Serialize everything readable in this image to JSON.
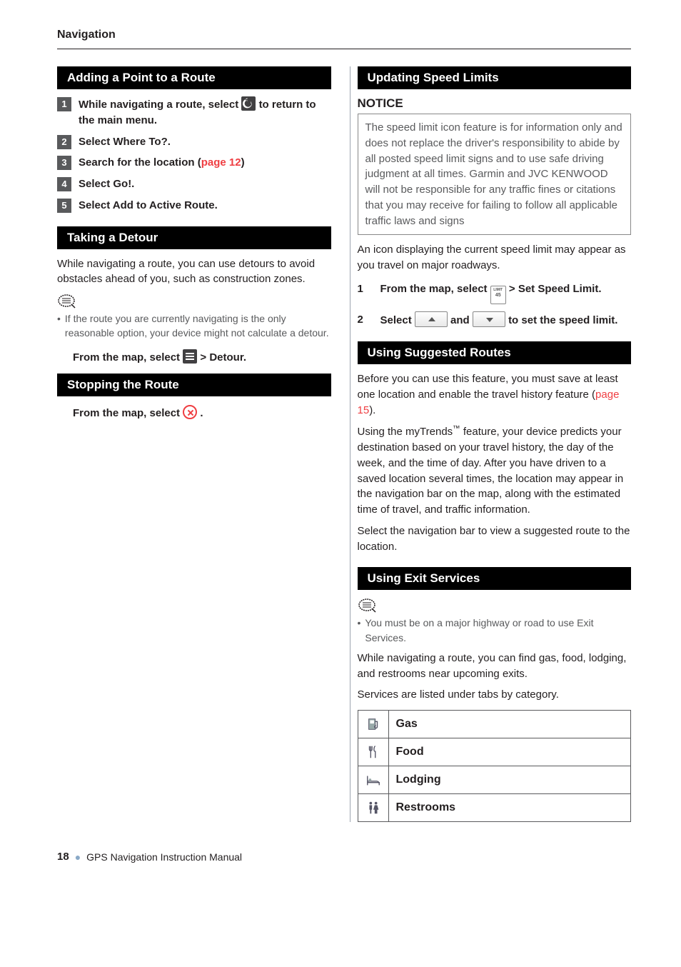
{
  "header": {
    "section": "Navigation"
  },
  "left": {
    "sec1": {
      "title": "Adding a Point to a Route",
      "steps": [
        {
          "pre": "While navigating a route, select ",
          "post": " to return to the main menu."
        },
        {
          "text": "Select Where To?."
        },
        {
          "pre": "Search for the location (",
          "link": "page 12",
          "post": ")"
        },
        {
          "text": "Select Go!."
        },
        {
          "text": "Select Add to Active Route."
        }
      ]
    },
    "sec2": {
      "title": "Taking a Detour",
      "intro": "While navigating a route, you can use detours to avoid obstacles ahead of you, such as construction zones.",
      "bullet": "If the route you are currently navigating is the only reasonable option, your device might not calculate a detour.",
      "instr_pre": "From the map, select ",
      "instr_post": " > Detour."
    },
    "sec3": {
      "title": "Stopping the Route",
      "instr_pre": "From the map, select ",
      "instr_post": "."
    }
  },
  "right": {
    "sec1": {
      "title": "Updating Speed Limits",
      "notice_title": "NOTICE",
      "notice_body": "The speed limit icon feature is for information only and does not replace the driver's responsibility to abide by all posted speed limit signs and to use safe driving judgment at all times. Garmin and JVC KENWOOD will not be responsible for any traffic fines or citations that you may receive for failing to follow all applicable traffic laws and signs",
      "intro": "An icon displaying the current speed limit may appear as you travel on major roadways.",
      "step1_pre": "From the map, select ",
      "step1_post": " > Set Speed Limit.",
      "step2_a": "Select ",
      "step2_b": " and ",
      "step2_c": " to set the speed limit."
    },
    "sec2": {
      "title": "Using Suggested Routes",
      "p1_pre": "Before you can use this feature, you must save at least one location and enable the travel history feature (",
      "p1_link": "page 15",
      "p1_post": ").",
      "p2a": "Using the myTrends",
      "p2b": " feature, your device predicts your destination based on your travel history, the day of the week, and the time of day. After you have driven to a saved location several times, the location may appear in the navigation bar on the map, along with the estimated time of travel, and traffic information.",
      "p3": "Select the navigation bar to view a suggested route to the location."
    },
    "sec3": {
      "title": "Using Exit Services",
      "bullet": "You must be on a major highway or road to use Exit Services.",
      "p1": "While navigating a route, you can find gas, food, lodging, and restrooms near upcoming exits.",
      "p2": "Services are listed under tabs by category.",
      "rows": [
        {
          "label": "Gas"
        },
        {
          "label": "Food"
        },
        {
          "label": "Lodging"
        },
        {
          "label": "Restrooms"
        }
      ]
    }
  },
  "footer": {
    "page": "18",
    "title": "GPS Navigation Instruction Manual"
  }
}
